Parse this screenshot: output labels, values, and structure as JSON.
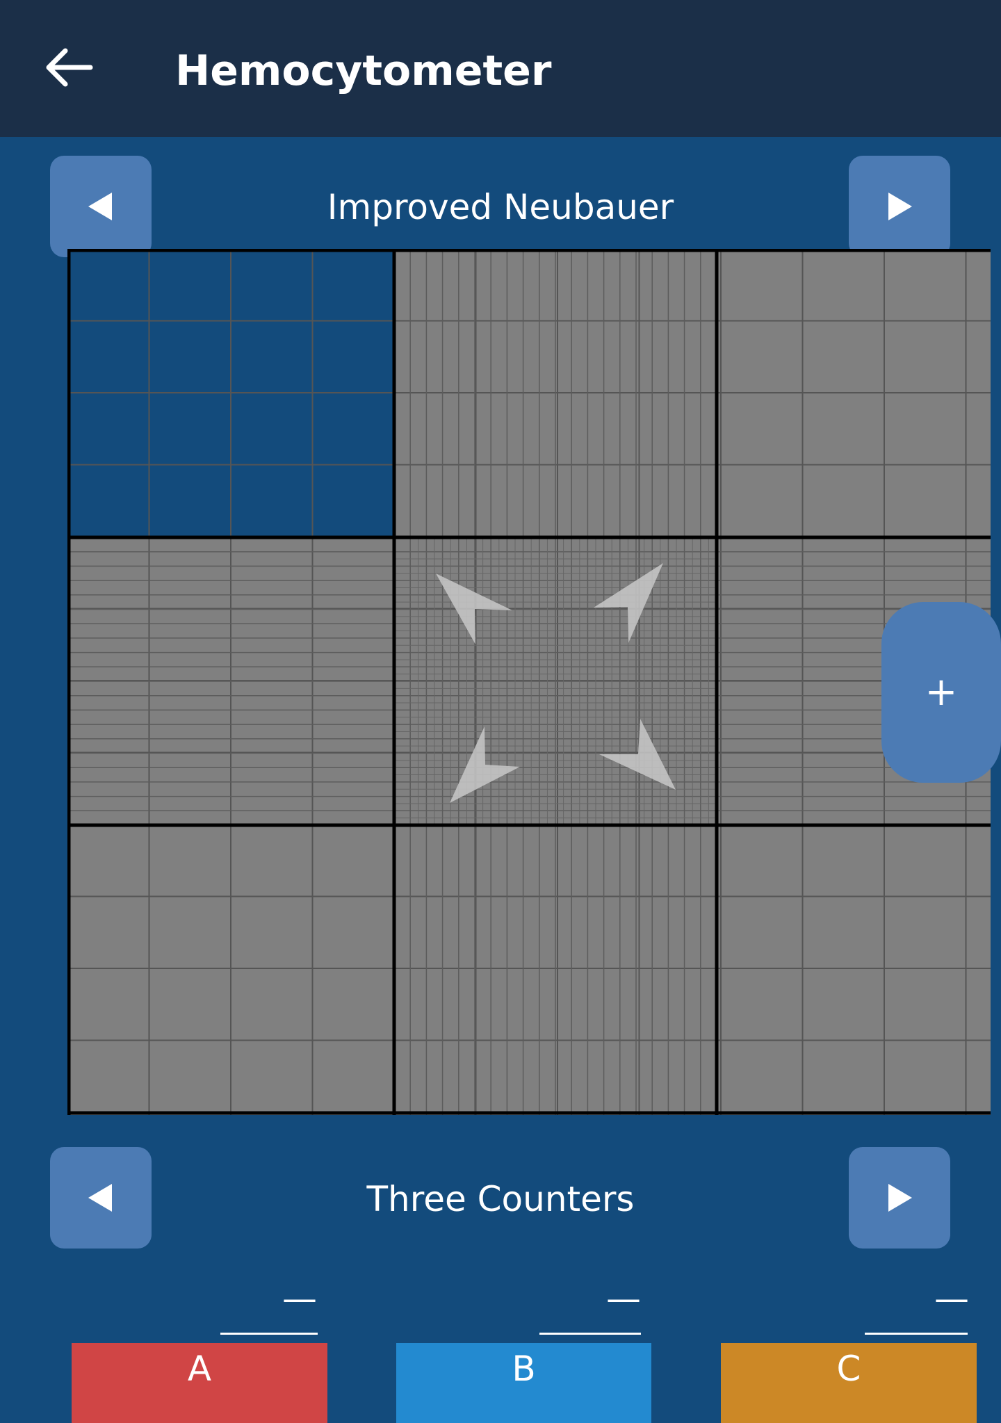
{
  "appbar": {
    "title": "Hemocytometer",
    "back_icon": "arrow-left-icon",
    "background": "#1b2f48"
  },
  "chamber_selector": {
    "label": "Improved Neubauer",
    "prev_icon": "triangle-left-icon",
    "next_icon": "triangle-right-icon"
  },
  "grid": {
    "selected_square_color": "#134b7c",
    "square_color": "#808080",
    "center_icon": "expand-arrows-icon"
  },
  "fab": {
    "label": "+",
    "icon": "plus-icon"
  },
  "counter_selector": {
    "label": "Three Counters",
    "prev_icon": "triangle-left-icon",
    "next_icon": "triangle-right-icon"
  },
  "counters": [
    {
      "label": "A",
      "count": "—",
      "color": "#d04545"
    },
    {
      "label": "B",
      "count": "—",
      "color": "#238ad0"
    },
    {
      "label": "C",
      "count": "—",
      "color": "#cc8826"
    }
  ],
  "colors": {
    "background": "#134b7c",
    "nav_button": "#4c7bb4"
  }
}
